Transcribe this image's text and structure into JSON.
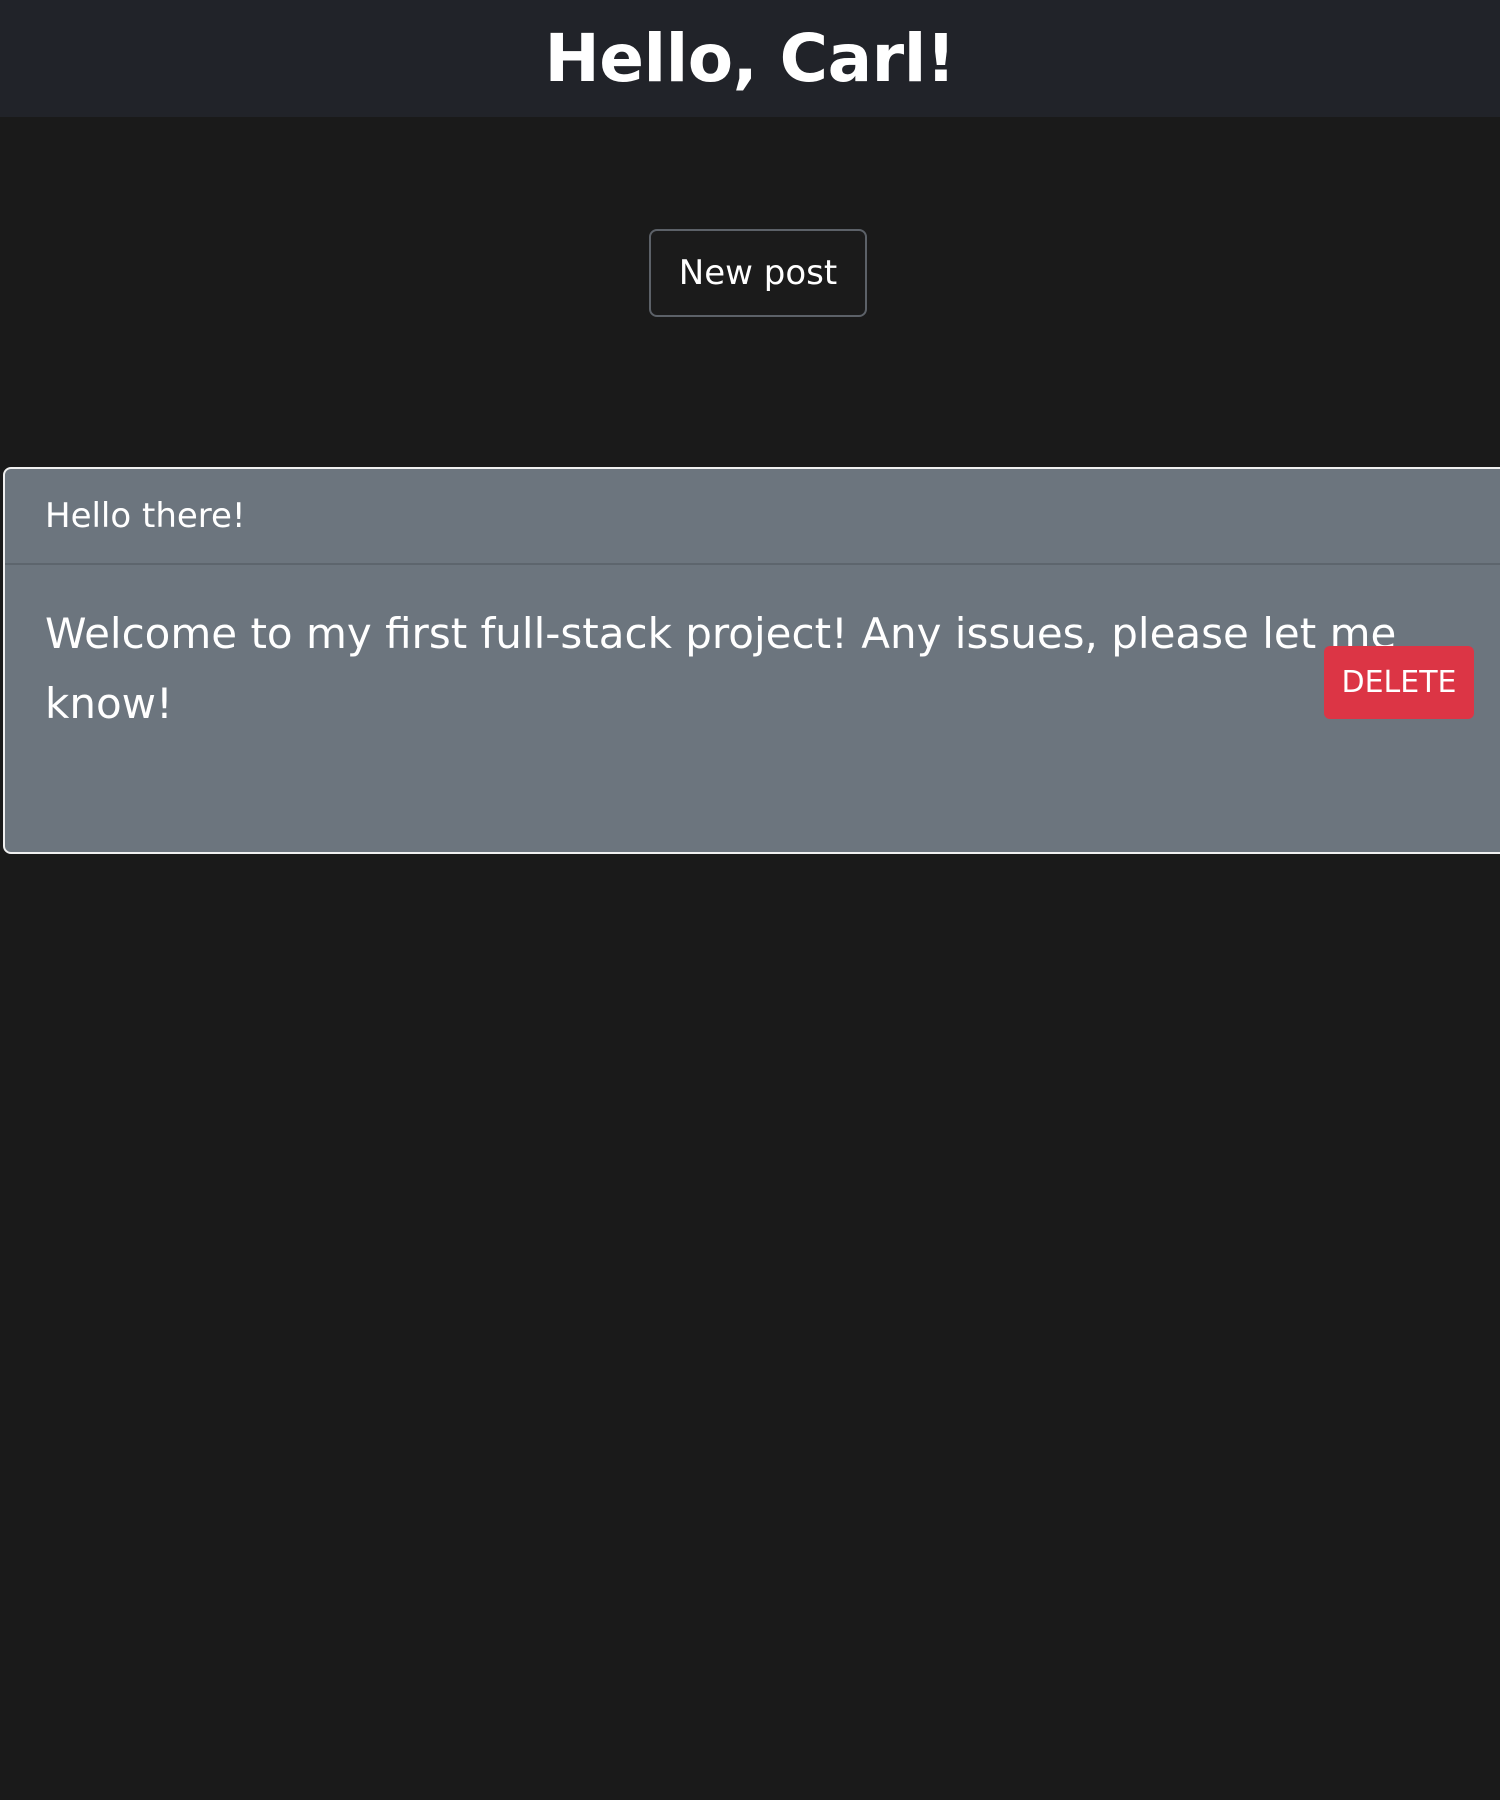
{
  "header": {
    "greeting": "Hello, Carl!"
  },
  "actions": {
    "new_post_label": "New post"
  },
  "posts": [
    {
      "title": "Hello there!",
      "body": "Welcome to my first full-stack project! Any issues, please let me know!",
      "delete_label": "DELETE"
    }
  ],
  "colors": {
    "background": "#1a1a1a",
    "header_bar": "#212329",
    "card_background": "#6c757e",
    "delete_button": "#dc3545",
    "text": "#ffffff"
  }
}
